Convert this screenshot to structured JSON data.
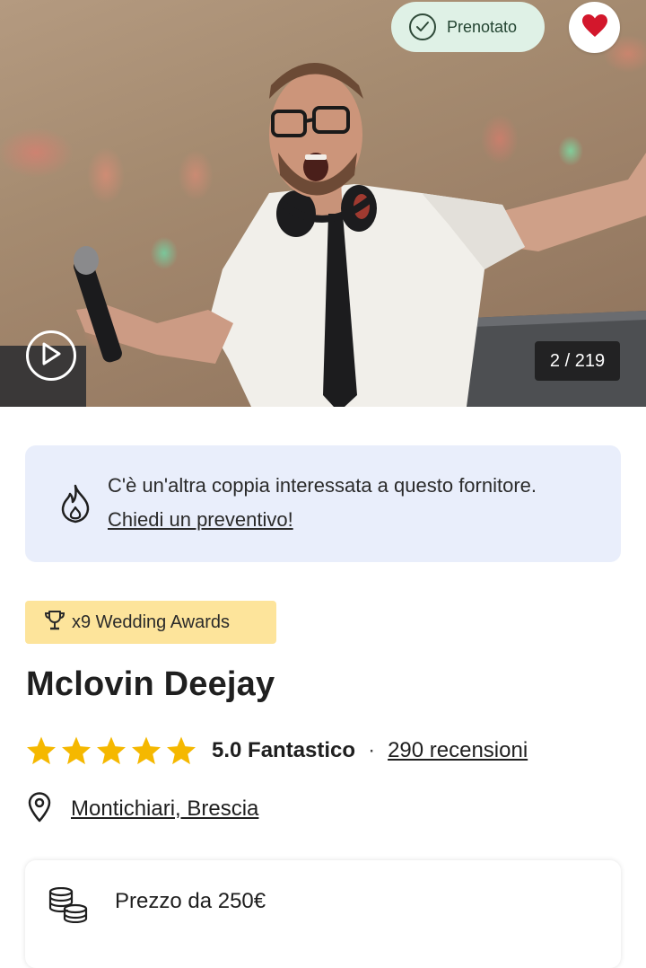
{
  "hero": {
    "booked_label": "Prenotato",
    "photo_counter": "2 / 219",
    "icons": {
      "booked": "check-circle-icon",
      "favorite": "heart-icon",
      "video": "play-icon"
    },
    "colors": {
      "heart": "#d3172c",
      "booked_bg": "#dff1e6"
    }
  },
  "alert": {
    "message": "C'è un'altra coppia interessata a questo fornitore.",
    "cta": "Chiedi un preventivo!",
    "icon": "fire-icon",
    "bg_color": "#e9eefb"
  },
  "awards": {
    "label": "x9 Wedding Awards",
    "icon": "trophy-icon",
    "bg_color": "#fde49b"
  },
  "vendor": {
    "name": "Mclovin Deejay"
  },
  "rating": {
    "stars": 5,
    "score_text": "5.0 Fantastico",
    "separator": "·",
    "reviews_text": "290 recensioni",
    "star_color": "#f5b800"
  },
  "location": {
    "text": "Montichiari, Brescia",
    "icon": "location-pin-icon"
  },
  "price": {
    "text": "Prezzo da 250€",
    "icon": "coins-icon"
  }
}
